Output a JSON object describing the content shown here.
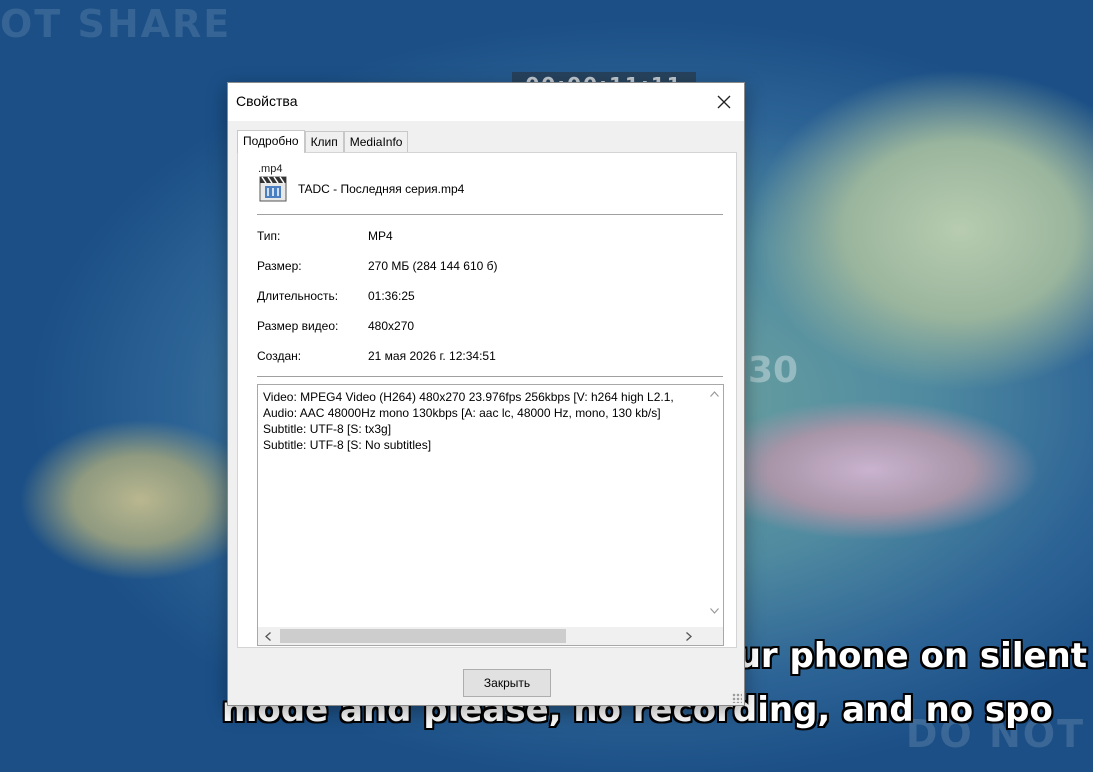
{
  "background": {
    "watermark_top": "OT SHARE",
    "timestamp": "00:00:11:11",
    "side_digit": "30",
    "watermark_bottom": "DO NOT",
    "subtitle_line1": "I also ask you to put your phone on silent",
    "subtitle_line2": "mode and please, no recording, and no spo"
  },
  "dialog": {
    "title": "Свойства",
    "tabs": [
      "Подробно",
      "Клип",
      "MediaInfo"
    ],
    "file": {
      "icon_ext": ".mp4",
      "name": "TADC - Последняя серия.mp4"
    },
    "properties": [
      {
        "label": "Тип:",
        "value": "MP4"
      },
      {
        "label": "Размер:",
        "value": "270 МБ (284 144 610 б)"
      },
      {
        "label": "Длительность:",
        "value": "01:36:25"
      },
      {
        "label": "Размер видео:",
        "value": "480x270"
      },
      {
        "label": "Создан:",
        "value": "21 мая 2026 г. 12:34:51"
      }
    ],
    "info_lines": [
      "Video: MPEG4 Video (H264) 480x270 23.976fps 256kbps [V: h264 high L2.1,",
      "Audio: AAC 48000Hz mono 130kbps [A: aac lc, 48000 Hz, mono, 130 kb/s]",
      "Subtitle: UTF-8 [S: tx3g]",
      "Subtitle: UTF-8 [S: No subtitles]"
    ],
    "close_button": "Закрыть"
  },
  "icons": {
    "close": "close-icon",
    "file": "video-file-icon",
    "scroll_up": "chevron-up-icon",
    "scroll_down": "chevron-down-icon",
    "scroll_left": "chevron-left-icon",
    "scroll_right": "chevron-right-icon"
  },
  "colors": {
    "dialog_bg": "#f0f0f0",
    "panel_bg": "#ffffff",
    "button_bg": "#e1e1e1"
  }
}
